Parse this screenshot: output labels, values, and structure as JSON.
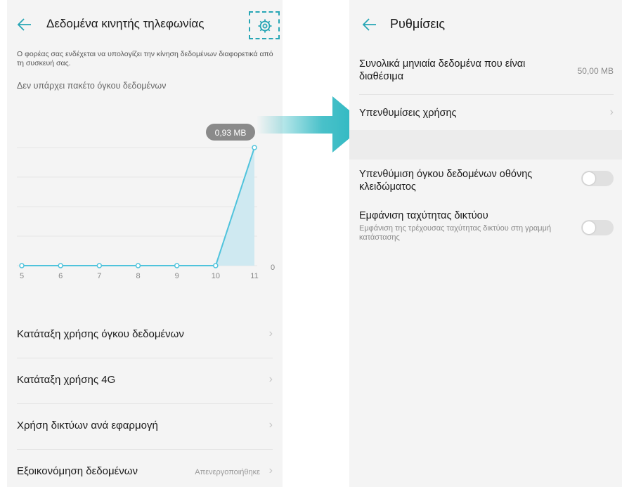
{
  "colors": {
    "accent": "#27a6b5",
    "arrow": "#29b6c0",
    "chart_fill": "#cfe9f1",
    "chart_line": "#4fc3dc"
  },
  "left": {
    "title": "Δεδομένα κινητής τηλεφωνίας",
    "note": "Ο φορέας σας ενδέχεται να υπολογίζει την κίνηση δεδομένων διαφορετικά από τη συσκευή σας.",
    "no_package": "Δεν υπάρχει πακέτο όγκου δεδομένων",
    "chart_badge": "0,93 MB",
    "zero_label": "0",
    "items": [
      {
        "label": "Κατάταξη χρήσης όγκου δεδομένων",
        "value": ""
      },
      {
        "label": "Κατάταξη χρήσης 4G",
        "value": ""
      },
      {
        "label": "Χρήση δικτύων ανά εφαρμογή",
        "value": ""
      },
      {
        "label": "Εξοικονόμηση δεδομένων",
        "value": "Απενεργοποιήθηκε"
      }
    ]
  },
  "right": {
    "title": "Ρυθμίσεις",
    "monthly_label": "Συνολικά μηνιαία δεδομένα που είναι διαθέσιμα",
    "monthly_value": "50,00 MB",
    "reminders_label": "Υπενθυμίσεις χρήσης",
    "lock_reminder_label": "Υπενθύμιση όγκου δεδομένων οθόνης κλειδώματος",
    "speed_label": "Εμφάνιση ταχύτητας δικτύου",
    "speed_sub": "Εμφάνιση της τρέχουσας ταχύτητας δικτύου στη γραμμή κατάστασης"
  },
  "chart_data": {
    "type": "area",
    "x": [
      "5",
      "6",
      "7",
      "8",
      "9",
      "10",
      "11"
    ],
    "series": [
      {
        "values": [
          0,
          0,
          0,
          0,
          0,
          0,
          0.93
        ]
      }
    ],
    "ylim": [
      0,
      0.93
    ],
    "grid": true
  }
}
